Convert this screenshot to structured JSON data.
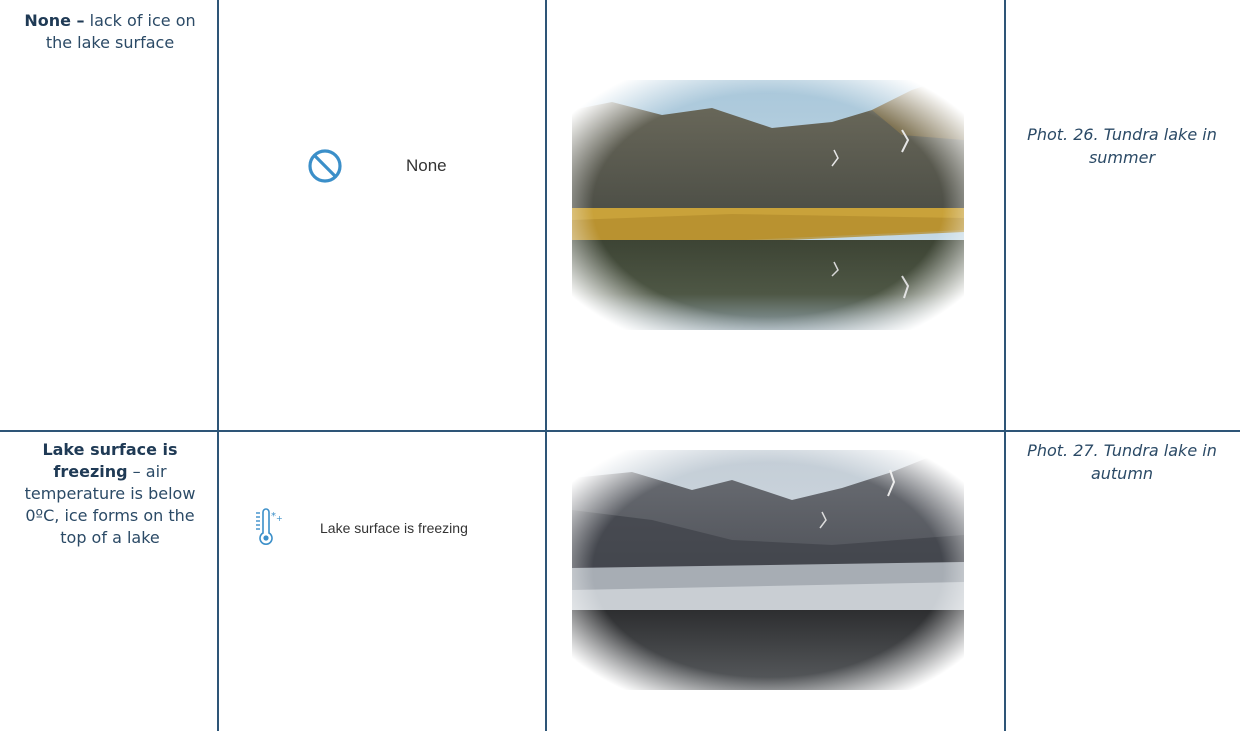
{
  "rows": [
    {
      "desc_bold": "None –",
      "desc_rest": " lack of ice on the lake surface",
      "icon": "prohibited-circle-icon",
      "icon_label": "None",
      "photo": "tundra-lake-summer",
      "caption": "Phot. 26. Tundra lake in summer"
    },
    {
      "desc_bold": "Lake surface is freezing",
      "desc_rest": " – air temperature is below 0ºC, ice forms on the top of a lake",
      "icon": "thermometer-snow-icon",
      "icon_label": "Lake surface is freezing",
      "photo": "tundra-lake-autumn",
      "caption": "Phot. 27. Tundra lake in autumn"
    }
  ],
  "colors": {
    "border": "#2e5577",
    "icon_blue": "#3b8fc9",
    "text": "#2b4a66"
  }
}
